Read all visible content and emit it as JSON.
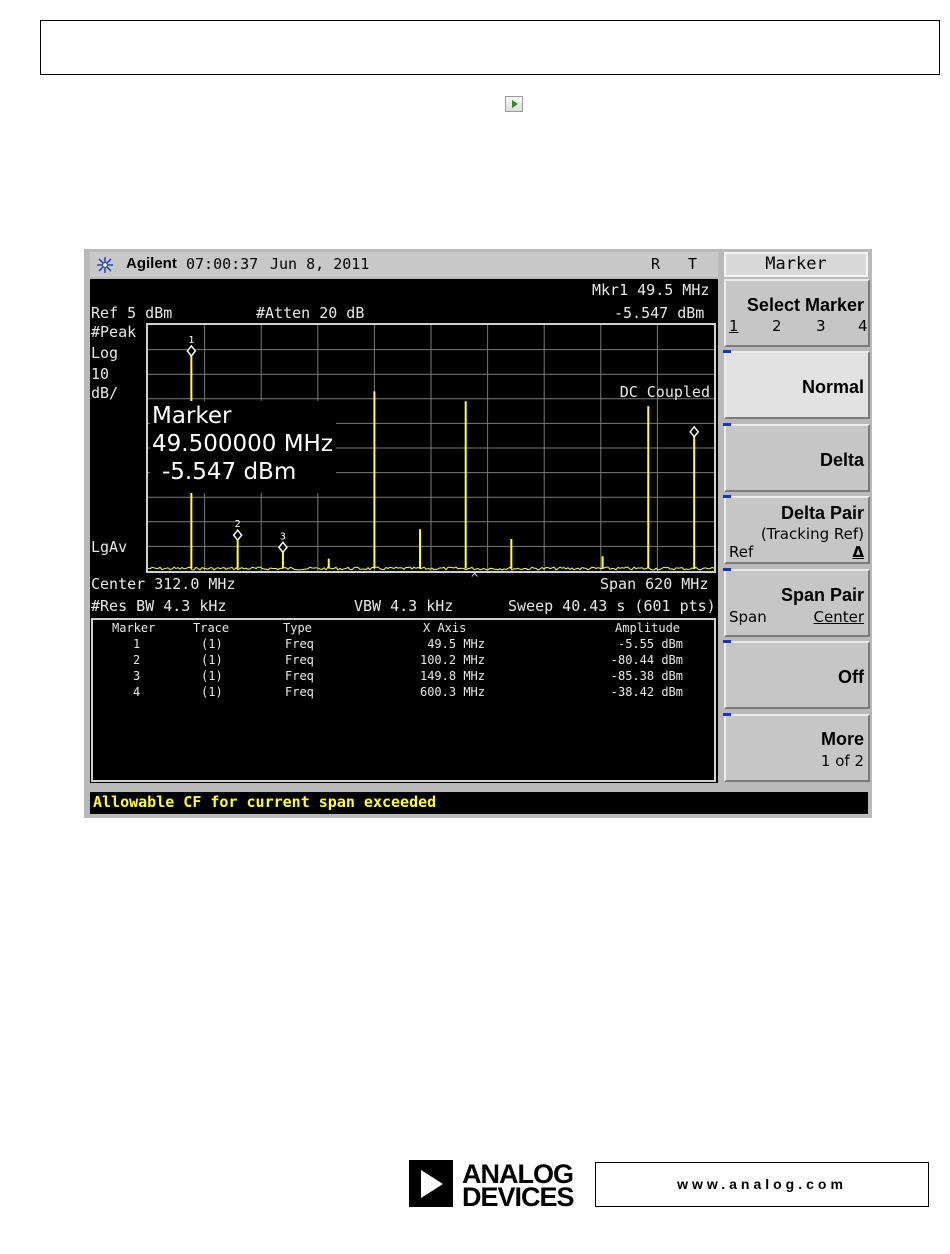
{
  "status_bar": {
    "brand": "Agilent",
    "time": "07:00:37",
    "date": "Jun 8, 2011",
    "r_indicator": "R",
    "t_indicator": "T"
  },
  "header": {
    "mkr_readout_freq": "Mkr1  49.5 MHz",
    "ref_level": "Ref 5 dBm",
    "atten": "#Atten 20 dB",
    "mkr_readout_amp": "-5.547 dBm"
  },
  "left_labels": {
    "detector": "#Peak",
    "scale_type": "Log",
    "scale_value": "10",
    "scale_unit": "dB/",
    "avg_type": "LgAv"
  },
  "marker_overlay": {
    "line1": "Marker",
    "line2": "49.500000 MHz",
    "line3": "-5.547 dBm"
  },
  "coupling_label": "DC Coupled",
  "marker_numbers": [
    "1",
    "2",
    "3"
  ],
  "bottom_info": {
    "center": "Center 312.0 MHz",
    "span": "Span 620 MHz",
    "res_bw": "#Res BW 4.3 kHz",
    "vbw": "VBW 4.3 kHz",
    "sweep": "Sweep 40.43 s (601 pts)",
    "caret": "^"
  },
  "marker_table": {
    "headers": [
      "Marker",
      "Trace",
      "Type",
      "X Axis",
      "Amplitude"
    ],
    "rows": [
      [
        "1",
        "(1)",
        "Freq",
        "49.5 MHz",
        "-5.55 dBm"
      ],
      [
        "2",
        "(1)",
        "Freq",
        "100.2 MHz",
        "-80.44 dBm"
      ],
      [
        "3",
        "(1)",
        "Freq",
        "149.8 MHz",
        "-85.38 dBm"
      ],
      [
        "4",
        "(1)",
        "Freq",
        "600.3 MHz",
        "-38.42 dBm"
      ]
    ]
  },
  "message": "Allowable CF for current span exceeded",
  "softkeys": {
    "title": "Marker",
    "select_marker": {
      "label": "Select Marker",
      "options": [
        "1",
        "2",
        "3",
        "4"
      ]
    },
    "normal": "Normal",
    "delta": "Delta",
    "delta_pair": {
      "label": "Delta Pair",
      "sub": "(Tracking Ref)",
      "left": "Ref",
      "right": "Δ"
    },
    "span_pair": {
      "label": "Span Pair",
      "left": "Span",
      "right": "Center"
    },
    "off": "Off",
    "more": {
      "label": "More",
      "sub": "1 of 2"
    }
  },
  "footer": {
    "logo_line1": "ANALOG",
    "logo_line2": "DEVICES",
    "website": "www.analog.com"
  },
  "colors": {
    "trace": "#ffff33",
    "screen_bg": "#000000",
    "graticule": "#7a7a7a",
    "message_text": "#ffff33"
  },
  "spectrum": {
    "start_freq_mhz": 2.0,
    "stop_freq_mhz": 622.0,
    "ref_level_dbm": 5,
    "db_per_div": 10,
    "noise_floor_dbm": -94,
    "peaks": [
      {
        "freq_mhz": 49.5,
        "amp_dbm": -5.547,
        "marker": "1"
      },
      {
        "freq_mhz": 100.2,
        "amp_dbm": -80.44,
        "marker": "2"
      },
      {
        "freq_mhz": 149.8,
        "amp_dbm": -85.38,
        "marker": "3"
      },
      {
        "freq_mhz": 200.0,
        "amp_dbm": -90
      },
      {
        "freq_mhz": 250.0,
        "amp_dbm": -22
      },
      {
        "freq_mhz": 300.0,
        "amp_dbm": -78
      },
      {
        "freq_mhz": 350.0,
        "amp_dbm": -26
      },
      {
        "freq_mhz": 400.0,
        "amp_dbm": -82
      },
      {
        "freq_mhz": 500.0,
        "amp_dbm": -89
      },
      {
        "freq_mhz": 550.0,
        "amp_dbm": -28
      },
      {
        "freq_mhz": 600.3,
        "amp_dbm": -38.42,
        "marker": "4"
      }
    ]
  }
}
